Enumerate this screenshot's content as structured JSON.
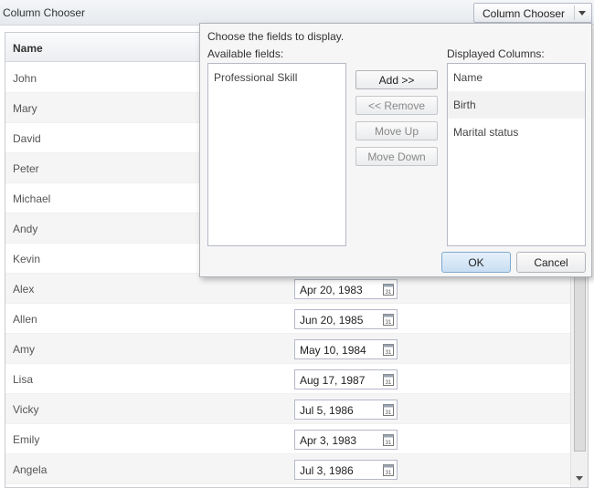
{
  "toolbar": {
    "title": "Column Chooser",
    "chooser_button_label": "Column Chooser"
  },
  "grid": {
    "header_name": "Name",
    "rows": [
      {
        "name": "John",
        "birth": ""
      },
      {
        "name": "Mary",
        "birth": ""
      },
      {
        "name": "David",
        "birth": ""
      },
      {
        "name": "Peter",
        "birth": ""
      },
      {
        "name": "Michael",
        "birth": ""
      },
      {
        "name": "Andy",
        "birth": ""
      },
      {
        "name": "Kevin",
        "birth": ""
      },
      {
        "name": "Alex",
        "birth": "Apr 20, 1983"
      },
      {
        "name": "Allen",
        "birth": "Jun 20, 1985"
      },
      {
        "name": "Amy",
        "birth": "May 10, 1984"
      },
      {
        "name": "Lisa",
        "birth": "Aug 17, 1987"
      },
      {
        "name": "Vicky",
        "birth": "Jul 5, 1986"
      },
      {
        "name": "Emily",
        "birth": "Apr 3, 1983"
      },
      {
        "name": "Angela",
        "birth": "Jul 3, 1986"
      }
    ]
  },
  "popup": {
    "instruction": "Choose the fields to display.",
    "available_label": "Available fields:",
    "displayed_label": "Displayed Columns:",
    "available_fields": [
      "Professional Skill"
    ],
    "displayed_columns": [
      "Name",
      "Birth",
      "Marital status"
    ],
    "add_label": "Add >>",
    "remove_label": "<< Remove",
    "move_up_label": "Move Up",
    "move_down_label": "Move Down",
    "ok_label": "OK",
    "cancel_label": "Cancel"
  }
}
